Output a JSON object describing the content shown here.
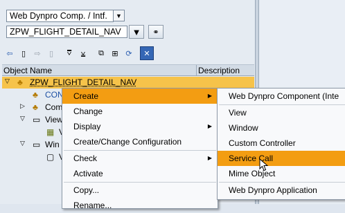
{
  "top": {
    "object_type": "Web Dynpro Comp. / Intf.",
    "object_name": "ZPW_FLIGHT_DETAIL_NAV"
  },
  "columns": {
    "object_name": "Object Name",
    "description": "Description"
  },
  "tree": {
    "root": "ZPW_FLIGHT_DETAIL_NAV",
    "children": [
      "CON",
      "Com",
      "View",
      "V",
      "Win",
      "V"
    ]
  },
  "context_menu": {
    "items": [
      {
        "label": "Create",
        "submenu": true,
        "highlighted": true
      },
      {
        "label": "Change"
      },
      {
        "label": "Display",
        "submenu": true
      },
      {
        "label": "Create/Change Configuration"
      },
      {
        "label": "Check",
        "submenu": true
      },
      {
        "label": "Activate"
      },
      {
        "label": "Copy..."
      },
      {
        "label": "Rename..."
      }
    ]
  },
  "submenu": {
    "items": [
      {
        "label": "Web Dynpro Component (Inte"
      },
      {
        "label": "View"
      },
      {
        "label": "Window"
      },
      {
        "label": "Custom Controller"
      },
      {
        "label": "Service Call",
        "highlighted": true
      },
      {
        "label": "Mime Object"
      },
      {
        "label": "Web Dynpro Application"
      }
    ]
  },
  "colors": {
    "highlight": "#f39d12",
    "selected_row": "#f6c34a"
  }
}
